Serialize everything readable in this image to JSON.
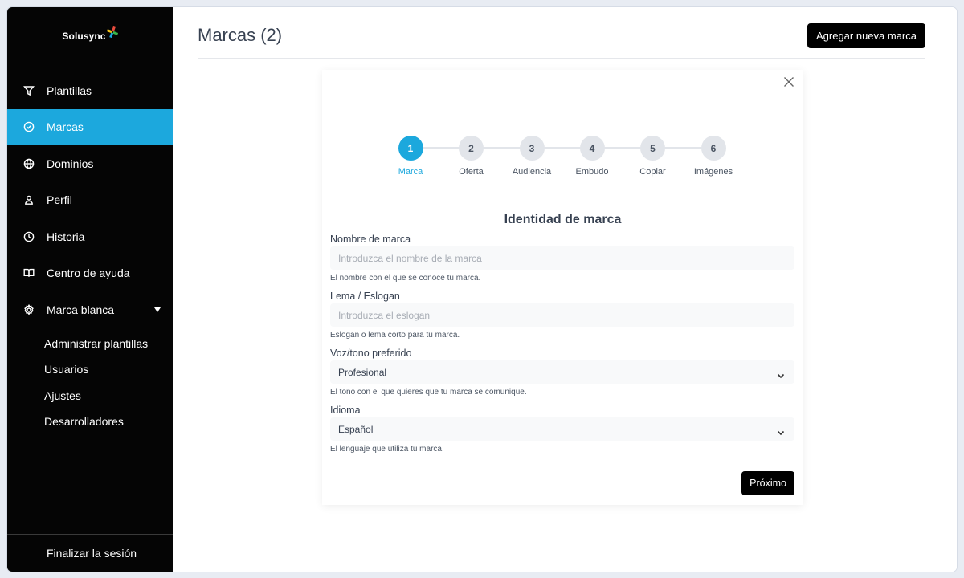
{
  "brand": {
    "name": "Solusync"
  },
  "sidebar": {
    "items": [
      {
        "label": "Plantillas",
        "icon": "filter-icon"
      },
      {
        "label": "Marcas",
        "icon": "check-circle-icon",
        "active": true
      },
      {
        "label": "Dominios",
        "icon": "globe-icon"
      },
      {
        "label": "Perfil",
        "icon": "user-icon"
      },
      {
        "label": "Historia",
        "icon": "clock-icon"
      },
      {
        "label": "Centro de ayuda",
        "icon": "book-icon"
      },
      {
        "label": "Marca blanca",
        "icon": "gear-icon",
        "expanded": true
      }
    ],
    "sub_items": [
      {
        "label": "Administrar plantillas"
      },
      {
        "label": "Usuarios"
      },
      {
        "label": "Ajustes"
      },
      {
        "label": "Desarrolladores"
      }
    ],
    "logout_label": "Finalizar la sesión"
  },
  "header": {
    "title": "Marcas (2)",
    "add_button_label": "Agregar nueva marca"
  },
  "wizard": {
    "steps": [
      {
        "number": "1",
        "label": "Marca",
        "active": true
      },
      {
        "number": "2",
        "label": "Oferta"
      },
      {
        "number": "3",
        "label": "Audiencia"
      },
      {
        "number": "4",
        "label": "Embudo"
      },
      {
        "number": "5",
        "label": "Copiar"
      },
      {
        "number": "6",
        "label": "Imágenes"
      }
    ],
    "section_title": "Identidad de marca",
    "fields": {
      "brand_name": {
        "label": "Nombre de marca",
        "value": "",
        "placeholder": "Introduzca el nombre de la marca",
        "help": "El nombre con el que se conoce tu marca."
      },
      "slogan": {
        "label": "Lema / Eslogan",
        "value": "",
        "placeholder": "Introduzca el eslogan",
        "help": "Eslogan o lema corto para tu marca."
      },
      "tone": {
        "label": "Voz/tono preferido",
        "value": "Profesional",
        "help": "El tono con el que quieres que tu marca se comunique."
      },
      "language": {
        "label": "Idioma",
        "value": "Español",
        "help": "El lenguaje que utiliza tu marca."
      }
    },
    "next_button_label": "Próximo"
  },
  "colors": {
    "accent": "#1ca8dd",
    "sidebar_bg": "#050505",
    "button_bg": "#000000"
  }
}
